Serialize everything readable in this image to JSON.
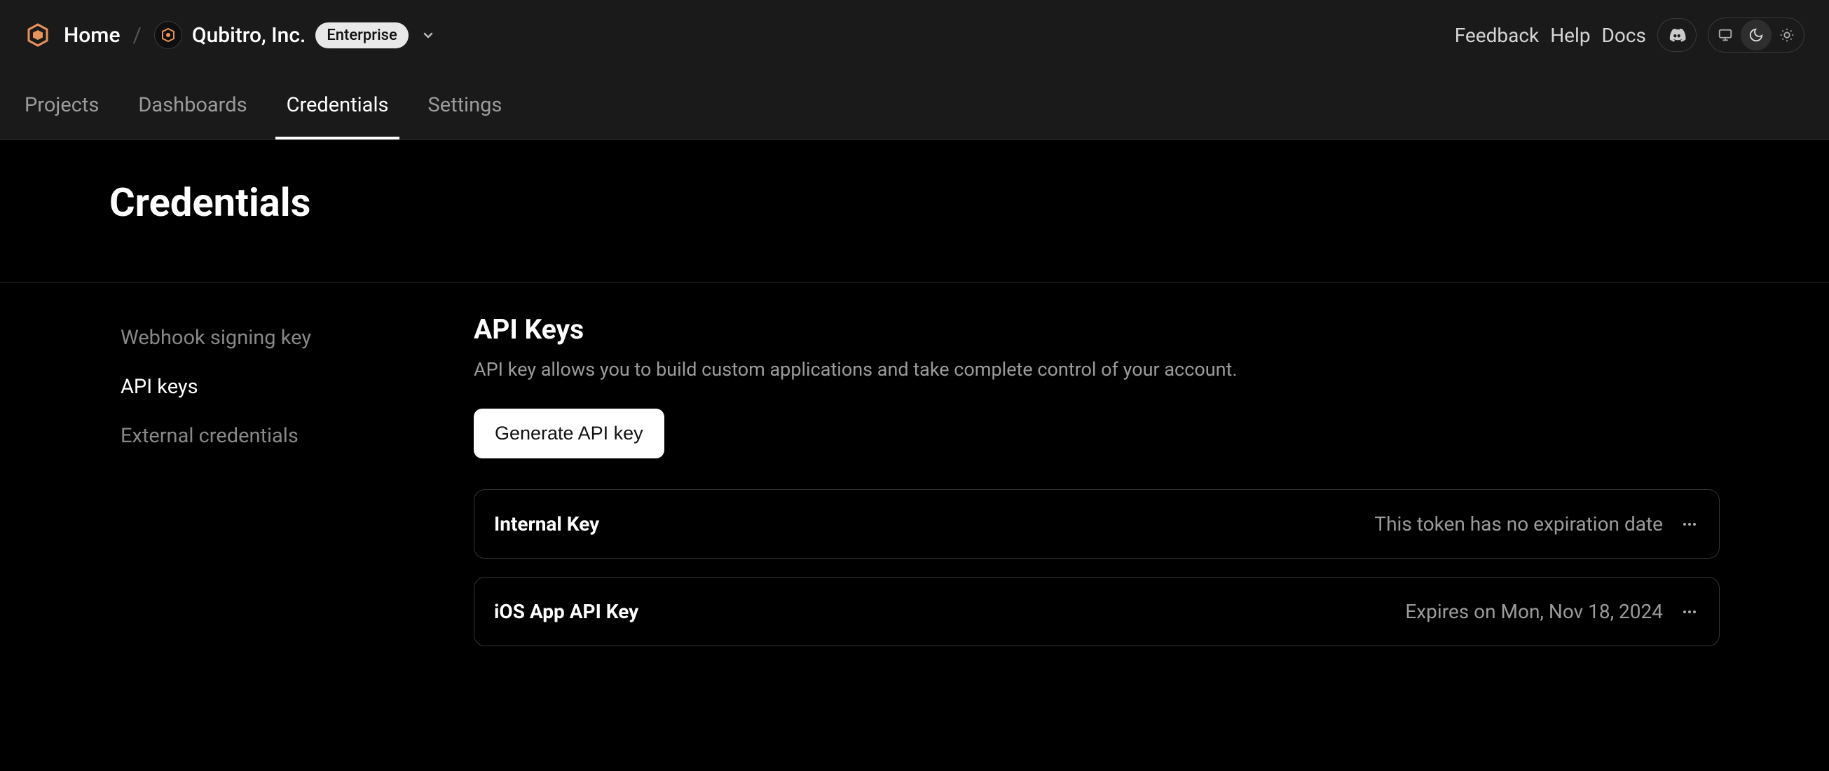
{
  "header": {
    "home_label": "Home",
    "org_name": "Qubitro, Inc.",
    "badge_label": "Enterprise",
    "links": {
      "feedback": "Feedback",
      "help": "Help",
      "docs": "Docs"
    }
  },
  "nav": {
    "projects": "Projects",
    "dashboards": "Dashboards",
    "credentials": "Credentials",
    "settings": "Settings",
    "active": "credentials"
  },
  "hero": {
    "title": "Credentials"
  },
  "sidebar": {
    "items": [
      {
        "label": "Webhook signing key"
      },
      {
        "label": "API keys"
      },
      {
        "label": "External credentials"
      }
    ],
    "active_index": 1
  },
  "main": {
    "section_title": "API Keys",
    "section_sub": "API key allows you to build custom applications and take complete control of your account.",
    "generate_btn": "Generate API key",
    "keys": [
      {
        "name": "Internal Key",
        "status": "This token has no expiration date"
      },
      {
        "name": "iOS App API Key",
        "status": "Expires on Mon, Nov 18, 2024"
      }
    ]
  }
}
